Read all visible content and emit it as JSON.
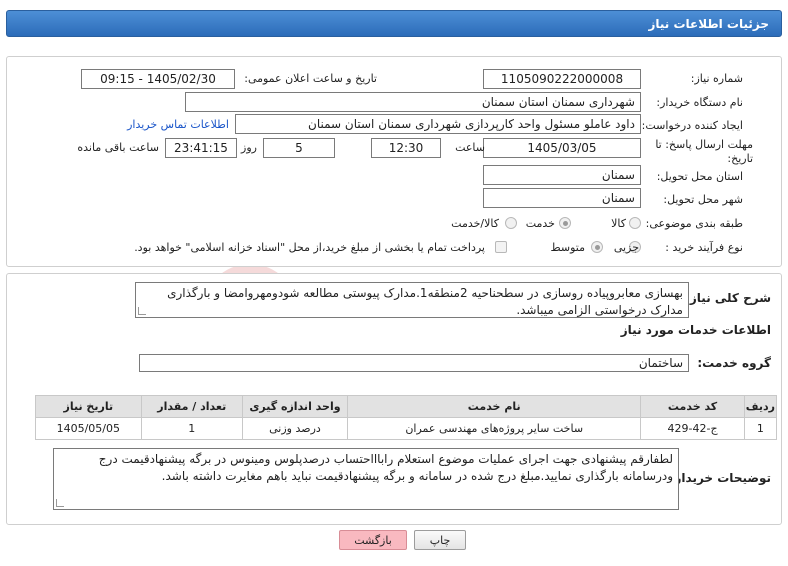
{
  "header": {
    "title": "جزئیات اطلاعات نیاز"
  },
  "form": {
    "need_number_label": "شماره نیاز:",
    "need_number": "1105090222000008",
    "announce_label": "تاریخ و ساعت اعلان عمومی:",
    "announce_value": "1405/02/30 - 09:15",
    "buyer_label": "نام دستگاه خریدار:",
    "buyer_value": "شهرداری سمنان استان سمنان",
    "creator_label": "ایجاد کننده درخواست:",
    "creator_value": "داود عاملو مسئول واحد کارپردازی شهرداری سمنان استان سمنان",
    "contact_link": "اطلاعات تماس خریدار",
    "deadline_label": "مهلت ارسال پاسخ: تا تاریخ:",
    "deadline_date": "1405/03/05",
    "time_label": "ساعت",
    "deadline_time": "12:30",
    "days_value": "5",
    "days_label": "روز و",
    "remaining_time": "23:41:15",
    "remaining_label": "ساعت باقی مانده",
    "province_label": "استان محل تحویل:",
    "province_value": "سمنان",
    "city_label": "شهر محل تحویل:",
    "city_value": "سمنان",
    "category_label": "طبقه بندی موضوعی:",
    "category_options": [
      "کالا",
      "خدمت",
      "کالا/خدمت"
    ],
    "category_selected": "خدمت",
    "process_label": "نوع فرآیند خرید :",
    "process_options": [
      "جزیی",
      "متوسط"
    ],
    "process_selected": "متوسط",
    "payment_note": "پرداخت تمام یا بخشی از مبلغ خرید،از محل \"اسناد خزانه اسلامی\" خواهد بود."
  },
  "description": {
    "label": "شرح کلی نیاز:",
    "text": "بهسازی معابروپیاده روسازی در سطحناحیه 2منطقه1.مدارک پیوستی مطالعه شودومهروامضا و بارگذاری مدارک درخواستی الزامی میباشد."
  },
  "services": {
    "section_title": "اطلاعات خدمات مورد نیاز",
    "group_label": "گروه خدمت:",
    "group_value": "ساختمان",
    "columns": [
      "ردیف",
      "کد خدمت",
      "نام خدمت",
      "واحد اندازه گیری",
      "تعداد / مقدار",
      "تاریخ نیاز"
    ],
    "rows": [
      [
        "1",
        "ج-42-429",
        "ساخت سایر پروژه‌های مهندسی عمران",
        "درصد وزنی",
        "1",
        "1405/05/05"
      ]
    ]
  },
  "buyer_notes": {
    "label": "توضیحات خریدار:",
    "text": "لطفارقم پیشنهادی جهت اجرای عملیات موضوع استعلام راباااحتساب درصدپلوس ومینوس در برگه پیشنهادقیمت درج ودرسامانه بارگذاری نمایید.مبلغ درج شده در سامانه و برگه پیشنهادقیمت نباید باهم مغایرت داشته باشد."
  },
  "buttons": {
    "print": "چاپ",
    "back": "بازگشت"
  },
  "watermark": {
    "text": "AriaTender.neT"
  },
  "colors": {
    "title_bar": "#3a7cc9",
    "back_button": "#f9b9c0",
    "link": "#1a55c9"
  },
  "icons": {
    "radio": "radio-button",
    "checkbox": "checkbox"
  }
}
